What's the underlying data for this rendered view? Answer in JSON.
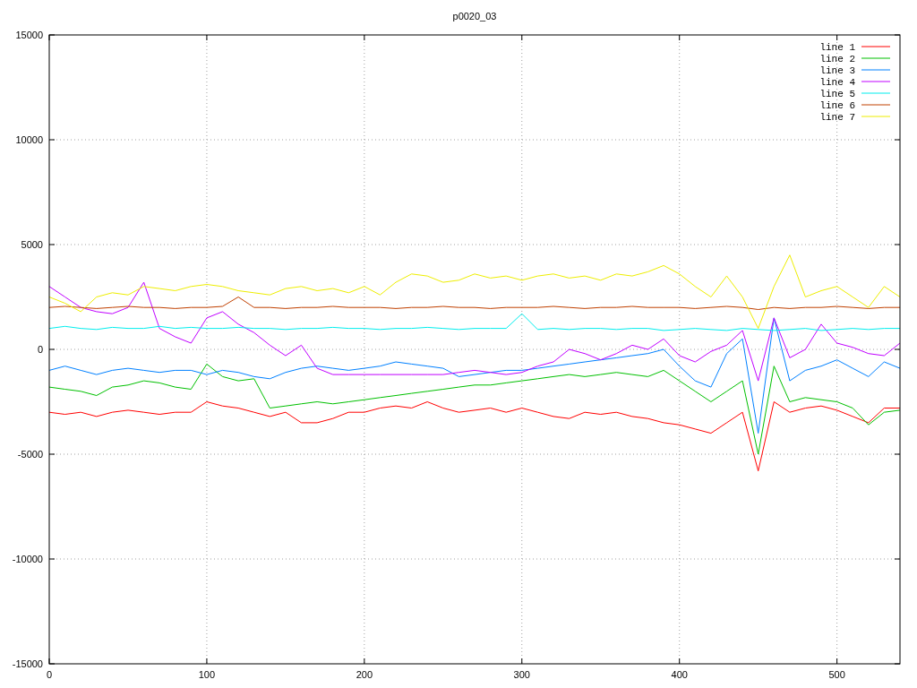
{
  "chart_data": {
    "type": "line",
    "title": "p0020_03",
    "x": [
      0,
      10,
      20,
      30,
      40,
      50,
      60,
      70,
      80,
      90,
      100,
      110,
      120,
      130,
      140,
      150,
      160,
      170,
      180,
      190,
      200,
      210,
      220,
      230,
      240,
      250,
      260,
      270,
      280,
      290,
      300,
      310,
      320,
      330,
      340,
      350,
      360,
      370,
      380,
      390,
      400,
      410,
      420,
      430,
      440,
      450,
      460,
      470,
      480,
      490,
      500,
      510,
      520,
      530,
      540
    ],
    "grid": true,
    "legend": true,
    "xlim": [
      0,
      540
    ],
    "ylim": [
      -15000,
      15000
    ],
    "xticks": [
      0,
      100,
      200,
      300,
      400,
      500
    ],
    "yticks": [
      -15000,
      -10000,
      -5000,
      0,
      5000,
      10000,
      15000
    ],
    "series": [
      {
        "name": "line 1",
        "color": "#ff0000",
        "values": [
          -3000,
          -3100,
          -3000,
          -3200,
          -3000,
          -2900,
          -3000,
          -3100,
          -3000,
          -3000,
          -2500,
          -2700,
          -2800,
          -3000,
          -3200,
          -3000,
          -3500,
          -3500,
          -3300,
          -3000,
          -3000,
          -2800,
          -2700,
          -2800,
          -2500,
          -2800,
          -3000,
          -2900,
          -2800,
          -3000,
          -2800,
          -3000,
          -3200,
          -3300,
          -3000,
          -3100,
          -3000,
          -3200,
          -3300,
          -3500,
          -3600,
          -3800,
          -4000,
          -3500,
          -3000,
          -5800,
          -2500,
          -3000,
          -2800,
          -2700,
          -2900,
          -3200,
          -3500,
          -2800,
          -2800
        ]
      },
      {
        "name": "line 2",
        "color": "#00c000",
        "values": [
          -1800,
          -1900,
          -2000,
          -2200,
          -1800,
          -1700,
          -1500,
          -1600,
          -1800,
          -1900,
          -700,
          -1300,
          -1500,
          -1400,
          -2800,
          -2700,
          -2600,
          -2500,
          -2600,
          -2500,
          -2400,
          -2300,
          -2200,
          -2100,
          -2000,
          -1900,
          -1800,
          -1700,
          -1700,
          -1600,
          -1500,
          -1400,
          -1300,
          -1200,
          -1300,
          -1200,
          -1100,
          -1200,
          -1300,
          -1000,
          -1500,
          -2000,
          -2500,
          -2000,
          -1500,
          -5000,
          -800,
          -2500,
          -2300,
          -2400,
          -2500,
          -2800,
          -3600,
          -3000,
          -2900
        ]
      },
      {
        "name": "line 3",
        "color": "#0080ff",
        "values": [
          -1000,
          -800,
          -1000,
          -1200,
          -1000,
          -900,
          -1000,
          -1100,
          -1000,
          -1000,
          -1200,
          -1000,
          -1100,
          -1300,
          -1400,
          -1100,
          -900,
          -800,
          -900,
          -1000,
          -900,
          -800,
          -600,
          -700,
          -800,
          -900,
          -1300,
          -1200,
          -1100,
          -1000,
          -1000,
          -900,
          -800,
          -700,
          -600,
          -500,
          -400,
          -300,
          -200,
          0,
          -800,
          -1500,
          -1800,
          -200,
          500,
          -4000,
          1500,
          -1500,
          -1000,
          -800,
          -500,
          -900,
          -1300,
          -600,
          -900
        ]
      },
      {
        "name": "line 4",
        "color": "#c000ff",
        "values": [
          3000,
          2500,
          2000,
          1800,
          1700,
          2000,
          3200,
          1000,
          600,
          300,
          1500,
          1800,
          1200,
          800,
          200,
          -300,
          200,
          -900,
          -1200,
          -1200,
          -1200,
          -1200,
          -1200,
          -1200,
          -1200,
          -1200,
          -1100,
          -1000,
          -1100,
          -1200,
          -1100,
          -800,
          -600,
          0,
          -200,
          -500,
          -200,
          200,
          0,
          500,
          -300,
          -600,
          -100,
          200,
          900,
          -1500,
          1500,
          -400,
          0,
          1200,
          300,
          100,
          -200,
          -300,
          300
        ]
      },
      {
        "name": "line 5",
        "color": "#00eeee",
        "values": [
          1000,
          1100,
          1000,
          950,
          1050,
          1000,
          1000,
          1100,
          1000,
          1050,
          1000,
          1000,
          1050,
          1000,
          1000,
          950,
          1000,
          1000,
          1050,
          1000,
          1000,
          950,
          1000,
          1000,
          1050,
          1000,
          950,
          1000,
          1000,
          1000,
          1700,
          950,
          1000,
          950,
          1000,
          1000,
          950,
          1000,
          1000,
          900,
          950,
          1000,
          950,
          900,
          1000,
          950,
          900,
          950,
          1000,
          900,
          950,
          1000,
          950,
          1000,
          1000
        ]
      },
      {
        "name": "line 6",
        "color": "#c04000",
        "values": [
          2000,
          2050,
          2000,
          1950,
          2000,
          2050,
          2000,
          2000,
          1950,
          2000,
          2000,
          2050,
          2500,
          2000,
          2000,
          1950,
          2000,
          2000,
          2050,
          2000,
          2000,
          2000,
          1950,
          2000,
          2000,
          2050,
          2000,
          2000,
          1950,
          2000,
          2000,
          2000,
          2050,
          2000,
          1950,
          2000,
          2000,
          2050,
          2000,
          2000,
          2000,
          1950,
          2000,
          2050,
          2000,
          1900,
          2000,
          1950,
          2000,
          2000,
          2050,
          2000,
          1950,
          2000,
          2000
        ]
      },
      {
        "name": "line 7",
        "color": "#eeee00",
        "values": [
          2500,
          2200,
          1800,
          2500,
          2700,
          2600,
          3000,
          2900,
          2800,
          3000,
          3100,
          3000,
          2800,
          2700,
          2600,
          2900,
          3000,
          2800,
          2900,
          2700,
          3000,
          2600,
          3200,
          3600,
          3500,
          3200,
          3300,
          3600,
          3400,
          3500,
          3300,
          3500,
          3600,
          3400,
          3500,
          3300,
          3600,
          3500,
          3700,
          4000,
          3600,
          3000,
          2500,
          3500,
          2500,
          1000,
          3000,
          4500,
          2500,
          2800,
          3000,
          2500,
          2000,
          3000,
          2500
        ]
      }
    ]
  }
}
